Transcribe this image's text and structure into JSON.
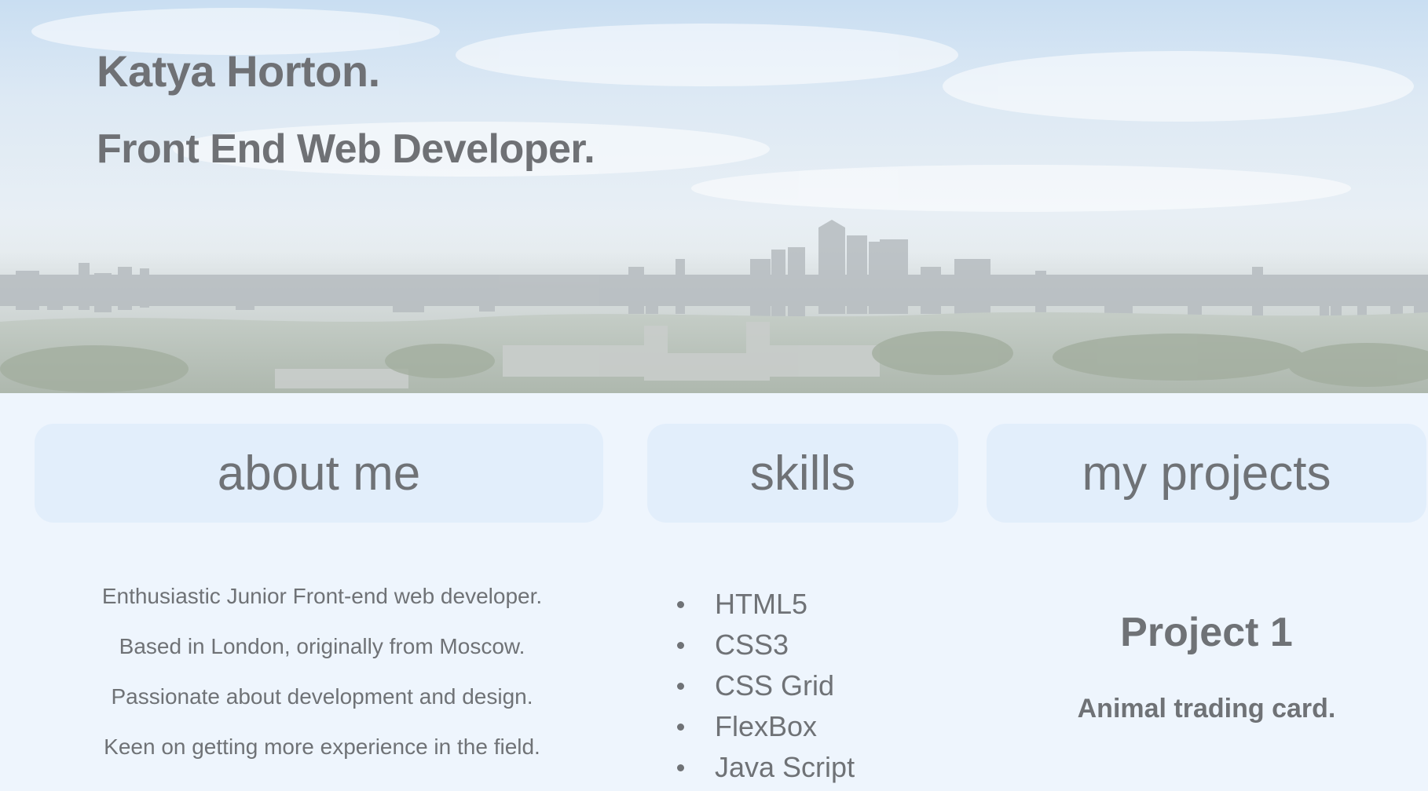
{
  "header": {
    "name": "Katya Horton.",
    "role": "Front End Web Developer."
  },
  "nav": {
    "about": "about me",
    "skills": "skills",
    "projects": "my projects"
  },
  "about": {
    "lines": [
      "Enthusiastic Junior Front-end web developer.",
      "Based in London, originally from Moscow.",
      "Passionate about development and design.",
      "Keen on getting more experience in the field."
    ]
  },
  "skills": {
    "items": [
      "HTML5",
      "CSS3",
      "CSS Grid",
      "FlexBox",
      "Java Script"
    ]
  },
  "projects": {
    "items": [
      {
        "title": "Project 1",
        "description": "Animal trading card."
      }
    ]
  },
  "colors": {
    "page_background": "#eef5fd",
    "tile_background": "#e2eefb",
    "text": "#6f7276"
  }
}
